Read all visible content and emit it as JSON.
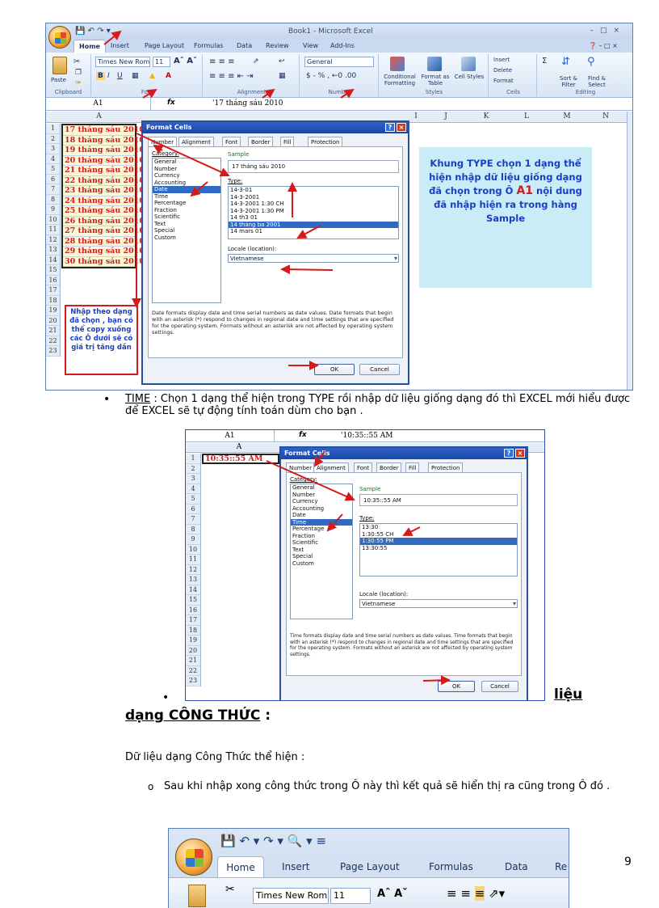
{
  "excel1": {
    "window_title": "Book1 - Microsoft Excel",
    "tabs": [
      "Home",
      "Insert",
      "Page Layout",
      "Formulas",
      "Data",
      "Review",
      "View",
      "Add-Ins"
    ],
    "font_name": "Times New Rom",
    "font_size": "11",
    "number_format": "General",
    "ribbon_buttons": {
      "paste": "Paste",
      "conditional": "Conditional Formatting",
      "format_table": "Format as Table",
      "cell_styles": "Cell Styles",
      "insert": "Insert",
      "delete": "Delete",
      "format": "Format",
      "sort": "Sort & Filter",
      "find": "Find & Select"
    },
    "groups": [
      "Clipboard",
      "Font",
      "Alignment",
      "Number",
      "Styles",
      "Cells",
      "Editing"
    ],
    "name_box": "A1",
    "formula": "'17 tháng sáu 2010",
    "columns": [
      "A",
      "I",
      "J",
      "K",
      "L",
      "M",
      "N"
    ],
    "rows": [
      "1",
      "2",
      "3",
      "4",
      "5",
      "6",
      "7",
      "8",
      "9",
      "10",
      "11",
      "12",
      "13",
      "14",
      "15",
      "16",
      "17",
      "18",
      "19",
      "20",
      "21",
      "22",
      "23"
    ],
    "cells_a": [
      "17 tháng sáu 2010",
      "18 tháng sáu 2010",
      "19 tháng sáu 2010",
      "20 tháng sáu 2010",
      "21 tháng sáu 2010",
      "22 tháng sáu 2010",
      "23 tháng sáu 2010",
      "24 tháng sáu 2010",
      "25 tháng sáu 2010",
      "26 tháng sáu 2010",
      "27 tháng sáu 2010",
      "28 tháng sáu 2010",
      "29 tháng sáu 2010",
      "30 tháng sáu 2010"
    ],
    "note_left": "Nhập theo dạng đã chọn , bạn có thể copy xuống các Ô dưới sẽ có giá trị tăng dần",
    "note_right": "Khung TYPE chọn 1 dạng thể hiện nhập dữ liệu giống dạng đã chọn trong Ô",
    "note_right_cell": "A1",
    "note_right_end": "nội dung đã nhập hiện ra trong hàng Sample",
    "dialog": {
      "title": "Format Cells",
      "tabs": [
        "Number",
        "Alignment",
        "Font",
        "Border",
        "Fill",
        "Protection"
      ],
      "category_label": "Category:",
      "categories": [
        "General",
        "Number",
        "Currency",
        "Accounting",
        "Date",
        "Time",
        "Percentage",
        "Fraction",
        "Scientific",
        "Text",
        "Special",
        "Custom"
      ],
      "selected_category": "Date",
      "sample_label": "Sample",
      "sample_value": "17 tháng sáu 2010",
      "type_label": "Type:",
      "types": [
        "14-3-01",
        "14-3-2001",
        "14-3-2001 1:30 CH",
        "14-3-2001 1:30 PM",
        "14 th3 01",
        "14 tháng ba 2001",
        "14 mars 01"
      ],
      "selected_type": "14 tháng ba 2001",
      "locale_label": "Locale (location):",
      "locale_value": "Vietnamese",
      "description": "Date formats display date and time serial numbers as date values.  Date formats that begin with an asterisk (*) respond to changes in regional date and time settings that are specified for the operating system. Formats without an asterisk are not affected by operating system settings.",
      "ok": "OK",
      "cancel": "Cancel"
    }
  },
  "text1": {
    "term": "TIME",
    "body": " : Chọn 1 dạng thể hiện trong TYPE rồi nhập dữ liệu giống dạng đó thì EXCEL mới hiểu được để EXCEL sẽ tự động tính toán dùm cho bạn ."
  },
  "excel2": {
    "name_box": "A1",
    "formula": "'10:35::55 AM",
    "column": "A",
    "rows": [
      "1",
      "2",
      "3",
      "4",
      "5",
      "6",
      "7",
      "8",
      "9",
      "10",
      "11",
      "12",
      "13",
      "14",
      "15",
      "16",
      "17",
      "18",
      "19",
      "20",
      "21",
      "22",
      "23"
    ],
    "cell_a1": "10:35::55 AM",
    "dialog": {
      "title": "Format Cells",
      "tabs": [
        "Number",
        "Alignment",
        "Font",
        "Border",
        "Fill",
        "Protection"
      ],
      "category_label": "Category:",
      "categories": [
        "General",
        "Number",
        "Currency",
        "Accounting",
        "Date",
        "Time",
        "Percentage",
        "Fraction",
        "Scientific",
        "Text",
        "Special",
        "Custom"
      ],
      "selected_category": "Time",
      "sample_label": "Sample",
      "sample_value": "10:35::55 AM",
      "type_label": "Type:",
      "types": [
        "13:30",
        "1:30:55 CH",
        "1:30:55 PM",
        "13:30:55"
      ],
      "selected_type": "1:30:55 PM",
      "locale_label": "Locale (location):",
      "locale_value": "Vietnamese",
      "description": "Time formats display date and time serial numbers as date values.  Time formats that begin with an asterisk (*) respond to changes in regional date and time settings that are specified for the operating system. Formats without an asterisk are not affected by operating system settings.",
      "ok": "OK",
      "cancel": "Cancel"
    }
  },
  "section": {
    "heading_word": "liệu",
    "heading_line2": "dạng CÔNG THỨC",
    "heading_colon": " :",
    "intro": "Dữ liệu dạng Công Thức thể hiện :",
    "sub_item": "Sau khi nhập xong công thức trong Ô này thì kết quả sẽ hiển thị ra cũng trong Ô đó ."
  },
  "excel3": {
    "tabs": [
      "Home",
      "Insert",
      "Page Layout",
      "Formulas",
      "Data",
      "Re"
    ],
    "font_name": "Times New Rom",
    "font_size": "11"
  },
  "page_number": "9"
}
